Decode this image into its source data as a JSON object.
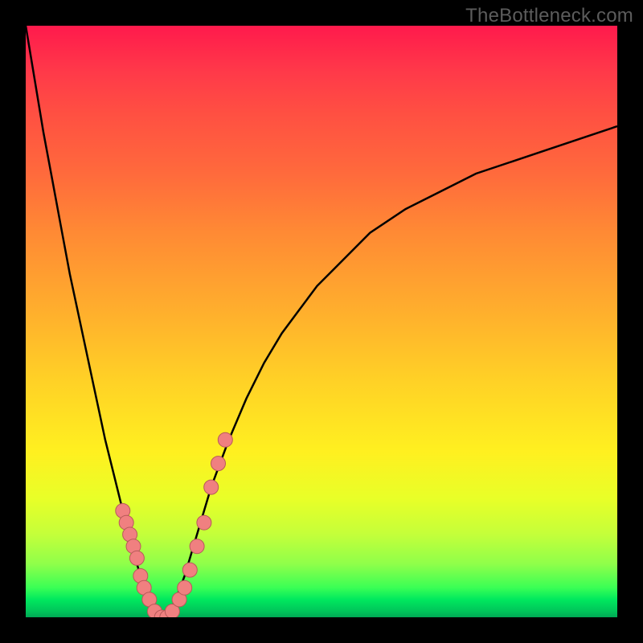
{
  "watermark": "TheBottleneck.com",
  "chart_data": {
    "type": "line",
    "title": "",
    "xlabel": "",
    "ylabel": "",
    "xlim": [
      0,
      3.6
    ],
    "ylim": [
      0,
      100
    ],
    "curve": {
      "x": [
        0.25,
        0.3,
        0.35,
        0.4,
        0.45,
        0.5,
        0.55,
        0.6,
        0.65,
        0.7,
        0.75,
        0.8,
        0.85,
        0.9,
        0.95,
        1.0,
        1.05,
        1.1,
        1.15,
        1.2,
        1.25,
        1.3,
        1.35,
        1.4,
        1.5,
        1.6,
        1.7,
        1.8,
        1.9,
        2.0,
        2.2,
        2.4,
        2.6,
        2.8,
        3.0,
        3.2,
        3.4,
        3.6
      ],
      "y": [
        100,
        91,
        82,
        74,
        66,
        58,
        51,
        44,
        37,
        30,
        24,
        18,
        12,
        7,
        3,
        0,
        0,
        3,
        7,
        12,
        17,
        22,
        26,
        30,
        37,
        43,
        48,
        52,
        56,
        59,
        65,
        69,
        72,
        75,
        77,
        79,
        81,
        83
      ]
    },
    "markers": {
      "x": [
        0.8,
        0.82,
        0.84,
        0.86,
        0.88,
        0.9,
        0.92,
        0.95,
        0.98,
        1.02,
        1.05,
        1.08,
        1.12,
        1.15,
        1.18,
        1.22,
        1.26,
        1.3,
        1.34,
        1.38
      ],
      "y": [
        18,
        16,
        14,
        12,
        10,
        7,
        5,
        3,
        1,
        0,
        0,
        1,
        3,
        5,
        8,
        12,
        16,
        22,
        26,
        30
      ]
    },
    "x_min_global": 0.25,
    "x_max_global": 3.6,
    "y_min_global": 0,
    "y_max_global": 100,
    "gradient_meaning": "vertical red→yellow→green"
  }
}
